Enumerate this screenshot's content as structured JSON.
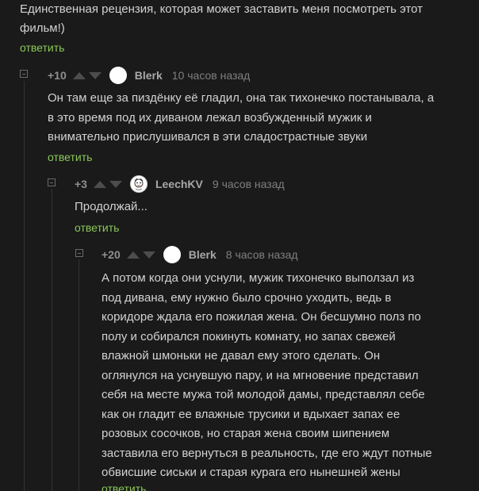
{
  "parent_comment": {
    "text_line1": "Единственная рецензия, которая может заставить меня посмотреть этот",
    "text_line2": "фильм!)",
    "reply_label": "ответить"
  },
  "comments": [
    {
      "rating": "+10",
      "username": "Blerk",
      "time": "10 часов назад",
      "avatar": "white-circle-avatar",
      "lines": [
        "Он там еще за пиздёнку её гладил, она так тихонечко постанывала, а",
        "в это время под их диваном лежал возбужденный мужик и",
        "внимательно прислушивался в эти сладострастные звуки"
      ],
      "reply_label": "ответить"
    },
    {
      "rating": "+3",
      "username": "LeechKV",
      "time": "9 часов назад",
      "avatar": "cartoon-avatar",
      "lines": [
        "Продолжай..."
      ],
      "reply_label": "ответить"
    },
    {
      "rating": "+20",
      "username": "Blerk",
      "time": "8 часов назад",
      "avatar": "white-circle-avatar",
      "lines": [
        "А потом когда они уснули, мужик тихонечко выползал из",
        "под дивана, ему нужно было срочно уходить, ведь в",
        "коридоре ждала его пожилая жена. Он бесшумно полз по",
        "полу и собирался покинуть комнату, но запах свежей",
        "влажной шмоньки не давал ему этого сделать. Он",
        "оглянулся на уснувшую пару, и на мгновение представил",
        "себя на месте мужа той молодой дамы, представлял себе",
        "как он гладит ее влажные трусики и вдыхает запах ее",
        "розовых сосочков, но старая жена своим шипением",
        "заставила его вернуться в реальность, где его ждут потные",
        "обвисшие сиськи и старая курага его нынешней жены"
      ],
      "reply_label": "ответить"
    }
  ],
  "colors": {
    "background": "#1a1a1a",
    "text": "#d2d2d2",
    "reply_link": "#8ac858",
    "muted": "#7f7f7f",
    "vote_arrow": "#4d4d4d"
  }
}
